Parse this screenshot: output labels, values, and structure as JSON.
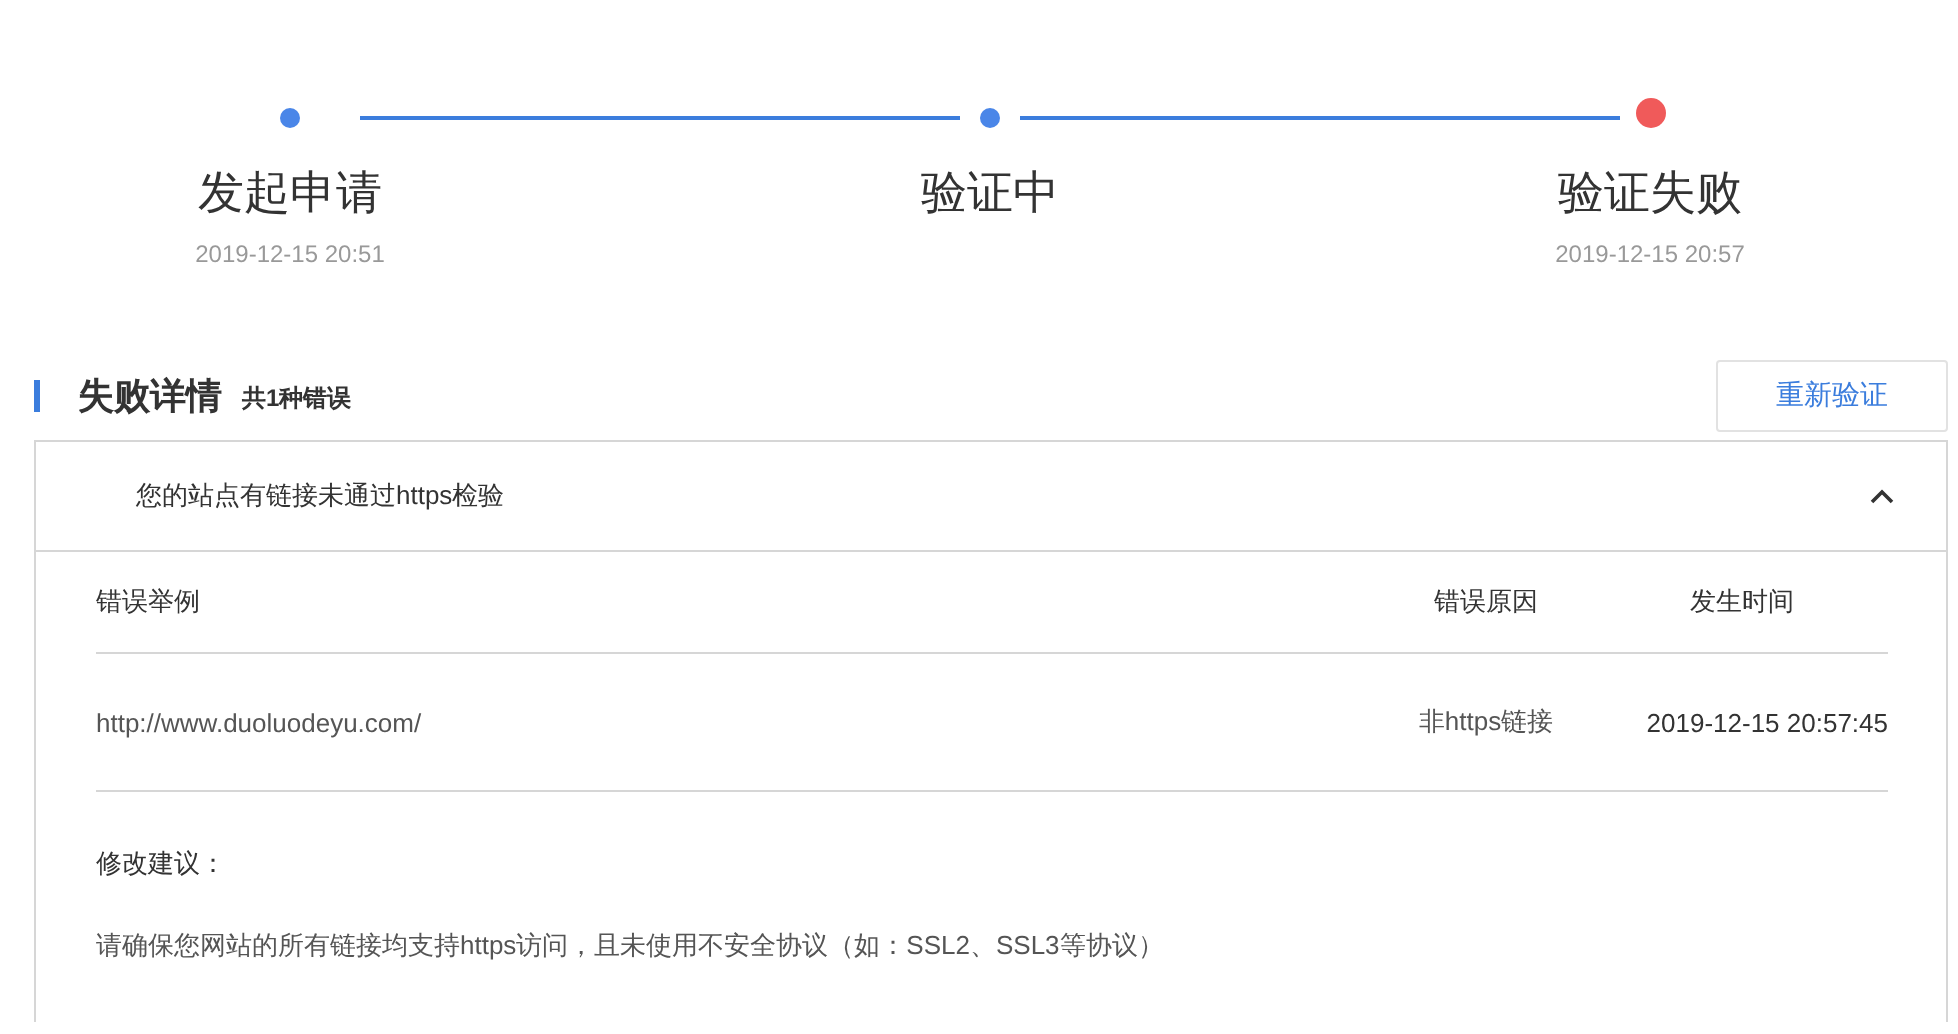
{
  "steps": [
    {
      "label": "发起申请",
      "time": "2019-12-15 20:51",
      "failed": false
    },
    {
      "label": "验证中",
      "failed": false
    },
    {
      "label": "验证失败",
      "time": "2019-12-15 20:57",
      "failed": true
    }
  ],
  "section": {
    "title": "失败详情",
    "count": "共1种错误",
    "button": "重新验证"
  },
  "panel": {
    "title": "您的站点有链接未通过https检验",
    "expanded": true,
    "columns": [
      "错误举例",
      "错误原因",
      "发生时间"
    ],
    "rows": [
      [
        "http://www.duoluodeyu.com/",
        "非https链接",
        "2019-12-15 20:57:45"
      ]
    ],
    "advice_title": "修改建议：",
    "advice": "请确保您网站的所有链接均支持https访问，且未使用不安全协议（如：SSL2、SSL3等协议）"
  }
}
